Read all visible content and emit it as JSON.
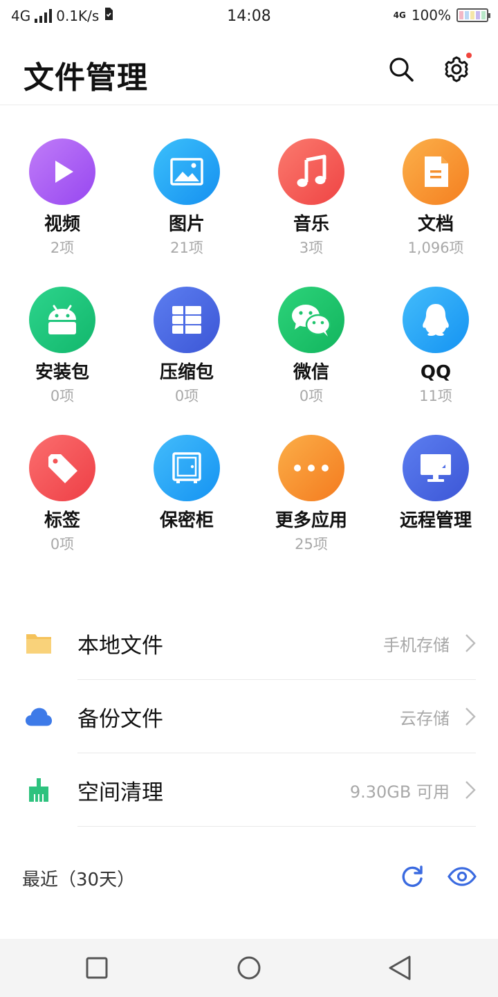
{
  "status_bar": {
    "network": "4G",
    "speed": "0.1K/s",
    "time": "14:08",
    "network_small": "4G",
    "battery": "100%"
  },
  "header": {
    "title": "文件管理"
  },
  "categories": [
    {
      "label": "视频",
      "count": "2项",
      "color": "#a45ff5",
      "icon": "play-icon"
    },
    {
      "label": "图片",
      "count": "21项",
      "color": "#25a6f6",
      "icon": "image-icon"
    },
    {
      "label": "音乐",
      "count": "3项",
      "color": "#f55a56",
      "icon": "music-note-icon"
    },
    {
      "label": "文档",
      "count": "1,096项",
      "color": "#f8962f",
      "icon": "document-icon"
    },
    {
      "label": "安装包",
      "count": "0项",
      "color": "#1ec47c",
      "icon": "android-icon"
    },
    {
      "label": "压缩包",
      "count": "0项",
      "color": "#4b6be6",
      "icon": "archive-icon"
    },
    {
      "label": "微信",
      "count": "0项",
      "color": "#1fc56d",
      "icon": "wechat-icon"
    },
    {
      "label": "QQ",
      "count": "11项",
      "color": "#28a8f6",
      "icon": "qq-penguin-icon"
    },
    {
      "label": "标签",
      "count": "0项",
      "color": "#f45456",
      "icon": "tag-icon"
    },
    {
      "label": "保密柜",
      "count": "",
      "color": "#28a8f6",
      "icon": "safe-icon"
    },
    {
      "label": "更多应用",
      "count": "25项",
      "color": "#f8922c",
      "icon": "more-dots-icon"
    },
    {
      "label": "远程管理",
      "count": "",
      "color": "#4b6be6",
      "icon": "monitor-icon"
    }
  ],
  "storage_rows": [
    {
      "label": "本地文件",
      "value": "手机存储",
      "icon": "folder-icon",
      "color": "#f7c864"
    },
    {
      "label": "备份文件",
      "value": "云存储",
      "icon": "cloud-icon",
      "color": "#3d7ae8"
    },
    {
      "label": "空间清理",
      "value": "9.30GB 可用",
      "icon": "broom-icon",
      "color": "#2ec27e"
    }
  ],
  "recent": {
    "title": "最近（30天）",
    "accent": "#3a6ae0"
  }
}
